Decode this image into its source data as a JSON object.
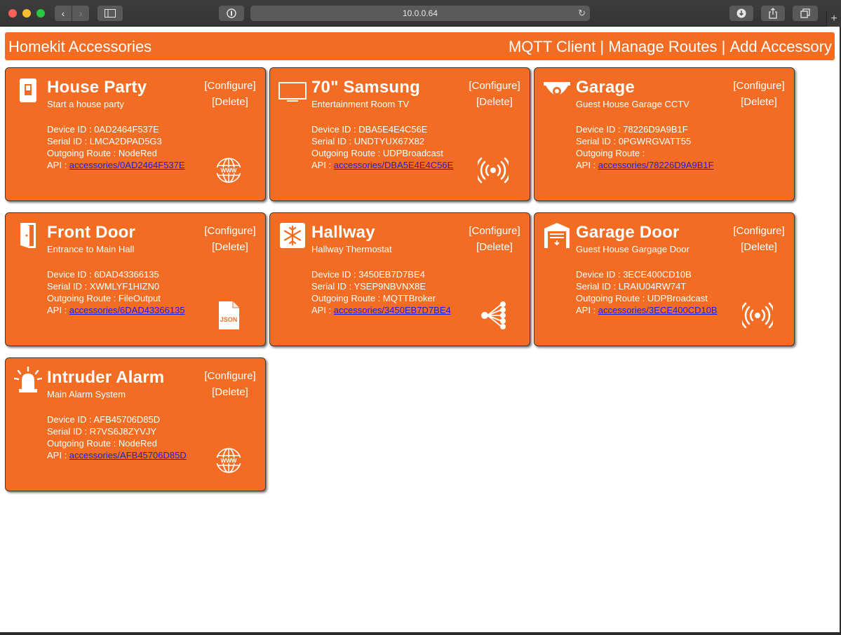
{
  "browser": {
    "address": "10.0.0.64"
  },
  "header": {
    "brand": "Homekit Accessories",
    "nav": [
      {
        "label": "MQTT Client"
      },
      {
        "label": "Manage Routes"
      },
      {
        "label": "Add Accessory"
      }
    ],
    "separator": " | "
  },
  "labels": {
    "configure": "[Configure]",
    "delete": "[Delete]",
    "device_id": "Device ID : ",
    "serial_id": "Serial ID : ",
    "outgoing_route": "Outgoing Route : ",
    "api": "API : "
  },
  "accessories": [
    {
      "title": "House Party",
      "subtitle": "Start a house party",
      "device_id": "0AD2464F537E",
      "serial_id": "LMCA2DPAD5G3",
      "route": "NodeRed",
      "api": "accessories/0AD2464F537E",
      "icon": "switch-icon",
      "route_icon": "www-globe-icon"
    },
    {
      "title": "70\" Samsung",
      "subtitle": "Entertainment Room TV",
      "device_id": "DBA5E4E4C56E",
      "serial_id": "UNDTYUX67X82",
      "route": "UDPBroadcast",
      "api": "accessories/DBA5E4E4C56E",
      "icon": "tv-icon",
      "route_icon": "broadcast-icon"
    },
    {
      "title": "Garage",
      "subtitle": "Guest House Garage CCTV",
      "device_id": "78226D9A9B1F",
      "serial_id": "0PGWRGVATT55",
      "route": "",
      "api": "accessories/78226D9A9B1F",
      "icon": "cctv-camera-icon",
      "route_icon": ""
    },
    {
      "title": "Front Door",
      "subtitle": "Entrance to Main Hall",
      "device_id": "6DAD43366135",
      "serial_id": "XWMLYF1HIZN0",
      "route": "FileOutput",
      "api": "accessories/6DAD43366135",
      "icon": "door-icon",
      "route_icon": "json-file-icon"
    },
    {
      "title": "Hallway",
      "subtitle": "Hallway Thermostat",
      "device_id": "3450EB7D7BE4",
      "serial_id": "YSEP9NBVNX8E",
      "route": "MQTTBroker",
      "api": "accessories/3450EB7D7BE4",
      "icon": "snowflake-icon",
      "route_icon": "mqtt-broker-icon"
    },
    {
      "title": "Garage Door",
      "subtitle": "Guest House Gargage Door",
      "device_id": "3ECE400CD10B",
      "serial_id": "LRAIU04RW74T",
      "route": "UDPBroadcast",
      "api": "accessories/3ECE400CD10B",
      "icon": "garage-door-icon",
      "route_icon": "broadcast-icon"
    },
    {
      "title": "Intruder Alarm",
      "subtitle": "Main Alarm System",
      "device_id": "AFB45706D85D",
      "serial_id": "R7VS6J8ZYVJY",
      "route": "NodeRed",
      "api": "accessories/AFB45706D85D",
      "icon": "alarm-siren-icon",
      "route_icon": "www-globe-icon"
    }
  ],
  "colors": {
    "accent": "#f26d23",
    "link": "#1d1de0"
  }
}
